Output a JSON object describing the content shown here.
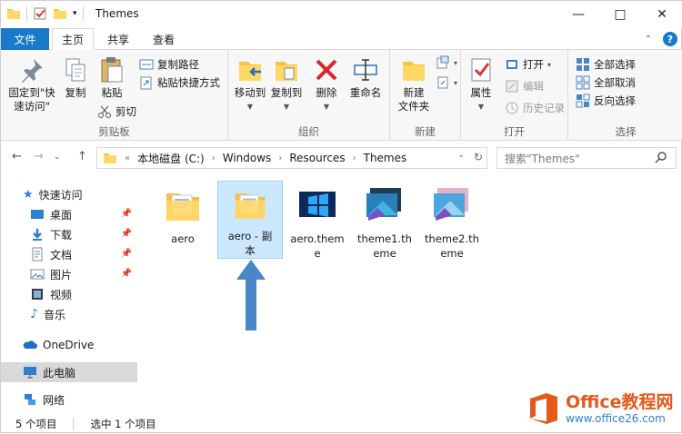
{
  "window": {
    "title": "Themes"
  },
  "tabs": {
    "file": "文件",
    "home": "主页",
    "share": "共享",
    "view": "查看"
  },
  "ribbon": {
    "clipboard": {
      "label": "剪贴板",
      "pin_quick_access": "固定到\"快\n速访问\"",
      "copy": "复制",
      "paste": "粘贴",
      "copy_path": "复制路径",
      "paste_shortcut": "粘贴快捷方式",
      "cut": "剪切"
    },
    "organize": {
      "label": "组织",
      "move_to": "移动到",
      "copy_to": "复制到",
      "delete": "删除",
      "rename": "重命名"
    },
    "new": {
      "label": "新建",
      "new_folder": "新建\n文件夹"
    },
    "open": {
      "label": "打开",
      "properties": "属性",
      "open": "打开",
      "edit": "编辑",
      "history": "历史记录"
    },
    "select": {
      "label": "选择",
      "select_all": "全部选择",
      "select_none": "全部取消",
      "invert": "反向选择"
    }
  },
  "address": {
    "prefix": "«",
    "crumbs": [
      "本地磁盘 (C:)",
      "Windows",
      "Resources",
      "Themes"
    ],
    "search_placeholder": "搜索\"Themes\""
  },
  "nav": {
    "quick_access": "快速访问",
    "desktop": "桌面",
    "downloads": "下载",
    "documents": "文档",
    "pictures": "图片",
    "videos": "视频",
    "music": "音乐",
    "onedrive": "OneDrive",
    "this_pc": "此电脑",
    "network": "网络"
  },
  "files": [
    {
      "name": "aero",
      "type": "folder"
    },
    {
      "name": "aero - 副\n本",
      "type": "folder",
      "selected": true
    },
    {
      "name": "aero.them\ne",
      "type": "theme"
    },
    {
      "name": "theme1.th\neme",
      "type": "theme"
    },
    {
      "name": "theme2.th\neme",
      "type": "theme"
    }
  ],
  "status": {
    "count": "5 个项目",
    "selected": "选中 1 个项目"
  },
  "watermark": {
    "title": "Office教程网",
    "url": "www.office26.com"
  },
  "colors": {
    "accent": "#1979ca",
    "selection": "#cce8ff",
    "arrow": "#4a86c8",
    "watermark_orange": "#e35a1a"
  }
}
